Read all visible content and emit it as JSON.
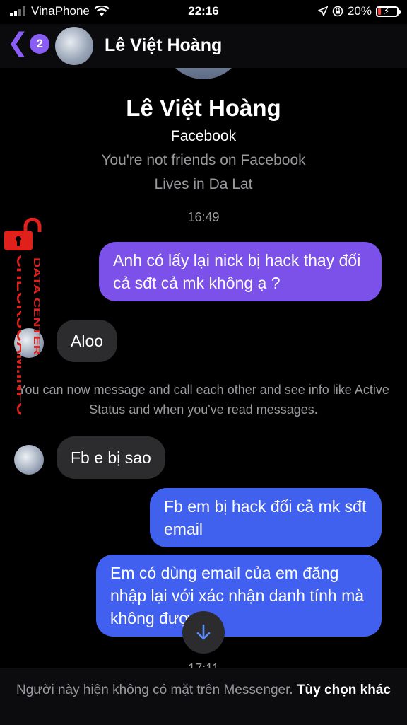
{
  "status_bar": {
    "carrier": "VinaPhone",
    "time": "22:16",
    "battery": "20%"
  },
  "header": {
    "back_badge": "2",
    "contact_name": "Lê Việt Hoàng"
  },
  "profile": {
    "name": "Lê Việt Hoàng",
    "platform": "Facebook",
    "friend_status": "You're not friends on Facebook",
    "location": "Lives in Da Lat"
  },
  "conversation": {
    "timestamp_1": "16:49",
    "msg_out_1": "Anh có lấy lại nick bị hack thay đổi cả sđt cả mk không ạ ?",
    "msg_in_1": "Aloo",
    "system_notice": "You can now message and call each other and see info like Active Status and when you've read messages.",
    "msg_in_2": "Fb e bị sao",
    "msg_out_2": "Fb em bị hack đổi cả mk sđt email",
    "msg_out_3": "Em có dùng email của em đăng nhập lại với xác nhận danh tính mà không được ạ",
    "timestamp_2": "17:11"
  },
  "footer": {
    "notice": "Người này hiện không có mặt trên Messenger.",
    "action": "Tùy chọn khác"
  },
  "watermark": {
    "main": "CHECKSCAM.INFO",
    "sub": "DATA CENTER"
  },
  "colors": {
    "accent": "#8a5cf6",
    "bubble_out_purple": "#7b51ea",
    "bubble_out_blue": "#4160f0",
    "bubble_in": "#2c2c2e",
    "watermark": "#e0201a"
  },
  "icons": [
    "chevron-left-icon",
    "signal-icon",
    "wifi-icon",
    "location-icon",
    "lock-rotation-icon",
    "battery-icon",
    "arrow-down-icon",
    "lock-icon"
  ]
}
